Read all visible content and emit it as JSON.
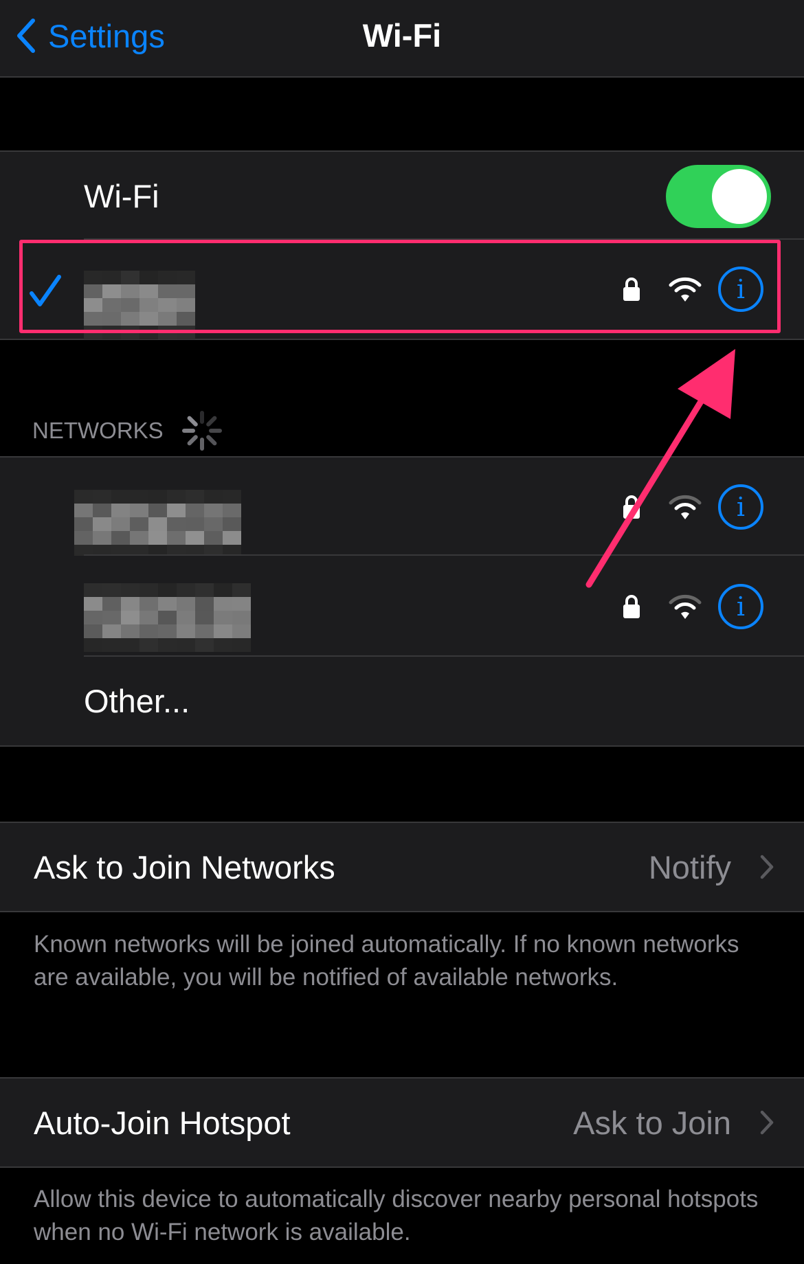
{
  "nav": {
    "back_label": "Settings",
    "title": "Wi-Fi"
  },
  "wifi_toggle": {
    "label": "Wi-Fi",
    "on": true,
    "color": "#30d158"
  },
  "connected_network": {
    "selected": true,
    "secured": true,
    "info_icon": "i"
  },
  "networks_header": "NETWORKS",
  "networks": [
    {
      "secured": true,
      "info_icon": "i"
    },
    {
      "secured": true,
      "info_icon": "i"
    }
  ],
  "other_label": "Other...",
  "ask_to_join": {
    "label": "Ask to Join Networks",
    "value": "Notify",
    "footer": "Known networks will be joined automatically. If no known networks are available, you will be notified of available networks."
  },
  "auto_join": {
    "label": "Auto-Join Hotspot",
    "value": "Ask to Join",
    "footer": "Allow this device to automatically discover nearby personal hotspots when no Wi-Fi network is available."
  },
  "colors": {
    "accent": "#0a84ff",
    "annotation": "#ff2d6f",
    "background": "#000000",
    "cell": "#1c1c1e"
  }
}
